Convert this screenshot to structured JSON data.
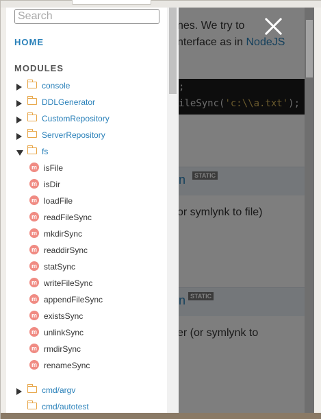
{
  "search": {
    "placeholder": "Search"
  },
  "nav": {
    "home_label": "HOME",
    "modules_heading": "MODULES"
  },
  "modules": [
    {
      "label": "console",
      "expanded": false
    },
    {
      "label": "DDLGenerator",
      "expanded": false
    },
    {
      "label": "CustomRepository",
      "expanded": false
    },
    {
      "label": "ServerRepository",
      "expanded": false
    },
    {
      "label": "fs",
      "expanded": true
    }
  ],
  "fs_methods": [
    {
      "badge": "m",
      "label": "isFile"
    },
    {
      "badge": "m",
      "label": "isDir"
    },
    {
      "badge": "m",
      "label": "loadFile"
    },
    {
      "badge": "m",
      "label": "readFileSync"
    },
    {
      "badge": "m",
      "label": "mkdirSync"
    },
    {
      "badge": "m",
      "label": "readdirSync"
    },
    {
      "badge": "m",
      "label": "statSync"
    },
    {
      "badge": "m",
      "label": "writeFileSync"
    },
    {
      "badge": "m",
      "label": "appendFileSync"
    },
    {
      "badge": "m",
      "label": "existsSync"
    },
    {
      "badge": "m",
      "label": "unlinkSync"
    },
    {
      "badge": "m",
      "label": "rmdirSync"
    },
    {
      "badge": "m",
      "label": "renameSync"
    }
  ],
  "modules_after": [
    {
      "label": "cmd/argv",
      "expanded": false,
      "has_toggle": true
    },
    {
      "label": "cmd/autotest",
      "expanded": false,
      "has_toggle": false
    }
  ],
  "background_page": {
    "line1": "nes. We try to",
    "line2_text": "nterface as in ",
    "line2_link": "NodeJS",
    "code_line1": ";",
    "code_line2_prefix": "ileSync(",
    "code_line2_string": "'c:\\\\a.txt'",
    "code_line2_suffix": ");",
    "section1_fn": "n",
    "section1_tag": "STATIC",
    "section1_desc": "or symlynk to file)",
    "section2_fn": "n",
    "section2_tag": "STATIC",
    "section2_desc": "er (or symlynk to"
  },
  "close_icon": "close-icon",
  "colors": {
    "link": "#2980b9",
    "folder_icon": "#e7a648",
    "method_badge": "#f08b83",
    "overlay": "rgba(0,0,0,0.5)"
  }
}
